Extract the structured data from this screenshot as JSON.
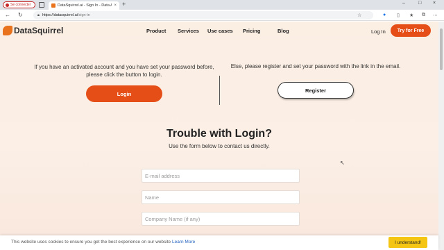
{
  "browser": {
    "profile_label": "Se connecter",
    "tab_title": "DataSquirrel.ai - Sign In - Data Analysis",
    "tab_close": "×",
    "new_tab": "+",
    "url_host": "https://datasquirrel.ai",
    "url_path": "/sign-in",
    "window_controls": [
      "–",
      "□",
      "×"
    ]
  },
  "site": {
    "logo_text": "DataSquirrel",
    "nav": [
      "Product",
      "Services",
      "Use cases",
      "Pricing",
      "Blog"
    ],
    "login_link": "Log In",
    "try_button": "Try for Free"
  },
  "signin": {
    "left_text": "If you have an activated account and you have set your password before, please click the button to login.",
    "login_button": "Login",
    "right_text": "Else, please register and set your password with the link in the email.",
    "register_button": "Register"
  },
  "trouble": {
    "heading": "Trouble with Login?",
    "subheading": "Use the form below to contact us directly.",
    "email_placeholder": "E-mail address",
    "name_placeholder": "Name",
    "company_placeholder": "Company Name (if any)"
  },
  "cookie": {
    "message": "This website uses cookies to ensure you get the best experience on our website",
    "learn_more": "Learn More",
    "button": "I understand!"
  },
  "colors": {
    "accent": "#e54e17",
    "cookie_button": "#f4c613"
  }
}
